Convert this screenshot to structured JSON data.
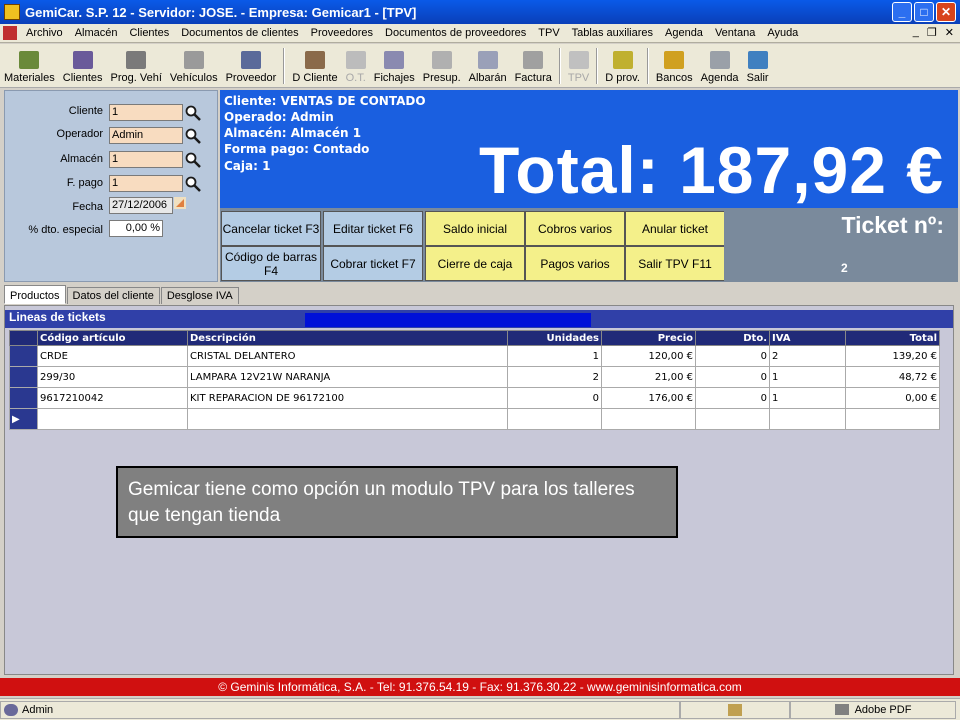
{
  "window": {
    "title": "GemiCar. S.P. 12 - Servidor: JOSE. - Empresa: Gemicar1 - [TPV]"
  },
  "menu": [
    "Archivo",
    "Almacén",
    "Clientes",
    "Documentos de clientes",
    "Proveedores",
    "Documentos de proveedores",
    "TPV",
    "Tablas auxiliares",
    "Agenda",
    "Ventana",
    "Ayuda"
  ],
  "toolbar": [
    {
      "label": "Materiales",
      "icon": "materials-icon",
      "color": "#6a8a3a",
      "disabled": false
    },
    {
      "label": "Clientes",
      "icon": "clients-icon",
      "color": "#6a5a9a",
      "disabled": false
    },
    {
      "label": "Prog. Vehí",
      "icon": "vehicle-program-icon",
      "color": "#7a7a7a",
      "disabled": false
    },
    {
      "label": "Vehículos",
      "icon": "vehicles-icon",
      "color": "#9a9a9a",
      "disabled": false
    },
    {
      "label": "Proveedor",
      "icon": "supplier-icon",
      "color": "#5a6a9a",
      "disabled": false
    },
    {
      "label": "D Cliente",
      "icon": "client-docs-icon",
      "color": "#8a6a4a",
      "disabled": false
    },
    {
      "label": "O.T.",
      "icon": "work-order-icon",
      "color": "#bcbcbc",
      "disabled": true
    },
    {
      "label": "Fichajes",
      "icon": "clock-in-icon",
      "color": "#8a8ab0",
      "disabled": false
    },
    {
      "label": "Presup.",
      "icon": "quote-icon",
      "color": "#b0b0b0",
      "disabled": false
    },
    {
      "label": "Albarán",
      "icon": "delivery-note-icon",
      "color": "#9aa0b8",
      "disabled": false
    },
    {
      "label": "Factura",
      "icon": "invoice-icon",
      "color": "#a0a0a0",
      "disabled": false
    },
    {
      "label": "TPV",
      "icon": "pos-icon",
      "color": "#c0c0c0",
      "disabled": true
    },
    {
      "label": "D prov.",
      "icon": "supplier-docs-icon",
      "color": "#c0b030",
      "disabled": false
    },
    {
      "label": "Bancos",
      "icon": "dollar-icon",
      "color": "#d0a020",
      "disabled": false
    },
    {
      "label": "Agenda",
      "icon": "agenda-icon",
      "color": "#9aa0a8",
      "disabled": false
    },
    {
      "label": "Salir",
      "icon": "exit-icon",
      "color": "#4080c0",
      "disabled": false
    }
  ],
  "form": {
    "cliente": {
      "label": "Cliente",
      "value": "1"
    },
    "operador": {
      "label": "Operador",
      "value": "Admin"
    },
    "almacen": {
      "label": "Almacén",
      "value": "1"
    },
    "fpago": {
      "label": "F. pago",
      "value": "1"
    },
    "fecha": {
      "label": "Fecha",
      "value": "27/12/2006"
    },
    "dto": {
      "label": "% dto. especial",
      "value": "0,00 %"
    }
  },
  "info": {
    "cliente": "Cliente: VENTAS DE CONTADO",
    "operado": "Operado: Admin",
    "almacen": "Almacén: Almacén 1",
    "forma_pago": "Forma pago: Contado",
    "caja": "Caja: 1",
    "total": "Total: 187,92 €"
  },
  "ticket": {
    "label": "Ticket nº:",
    "number": "2"
  },
  "actions": {
    "cancelar": "Cancelar ticket F3",
    "editar": "Editar ticket F6",
    "saldo": "Saldo inicial",
    "cobros": "Cobros varios",
    "anular": "Anular ticket",
    "codigo": "Código de barras F4",
    "cobrar": "Cobrar ticket F7",
    "cierre": "Cierre de caja",
    "pagos": "Pagos varios",
    "salir": "Salir TPV F11"
  },
  "tabs": [
    "Productos",
    "Datos del cliente",
    "Desglose IVA"
  ],
  "grid": {
    "title": "Lineas de tickets",
    "columns": [
      "Código artículo",
      "Descripción",
      "Unidades",
      "Precio",
      "Dto.",
      "IVA",
      "Total"
    ],
    "rows": [
      [
        "CRDE",
        "CRISTAL DELANTERO",
        "1",
        "120,00 €",
        "0",
        "2",
        "139,20 €"
      ],
      [
        "299/30",
        "LAMPARA 12V21W NARANJA",
        "2",
        "21,00 €",
        "0",
        "1",
        "48,72 €"
      ],
      [
        "9617210042",
        "KIT REPARACION DE 96172100",
        "0",
        "176,00 €",
        "0",
        "1",
        "0,00 €"
      ]
    ]
  },
  "caption": "Gemicar  tiene como opción un modulo TPV para los talleres que tengan tienda",
  "footer": "© Geminis Informática, S.A. - Tel: 91.376.54.19 - Fax: 91.376.30.22 - www.geminisinformatica.com",
  "status": {
    "user": "Admin",
    "printer": "Adobe PDF"
  }
}
